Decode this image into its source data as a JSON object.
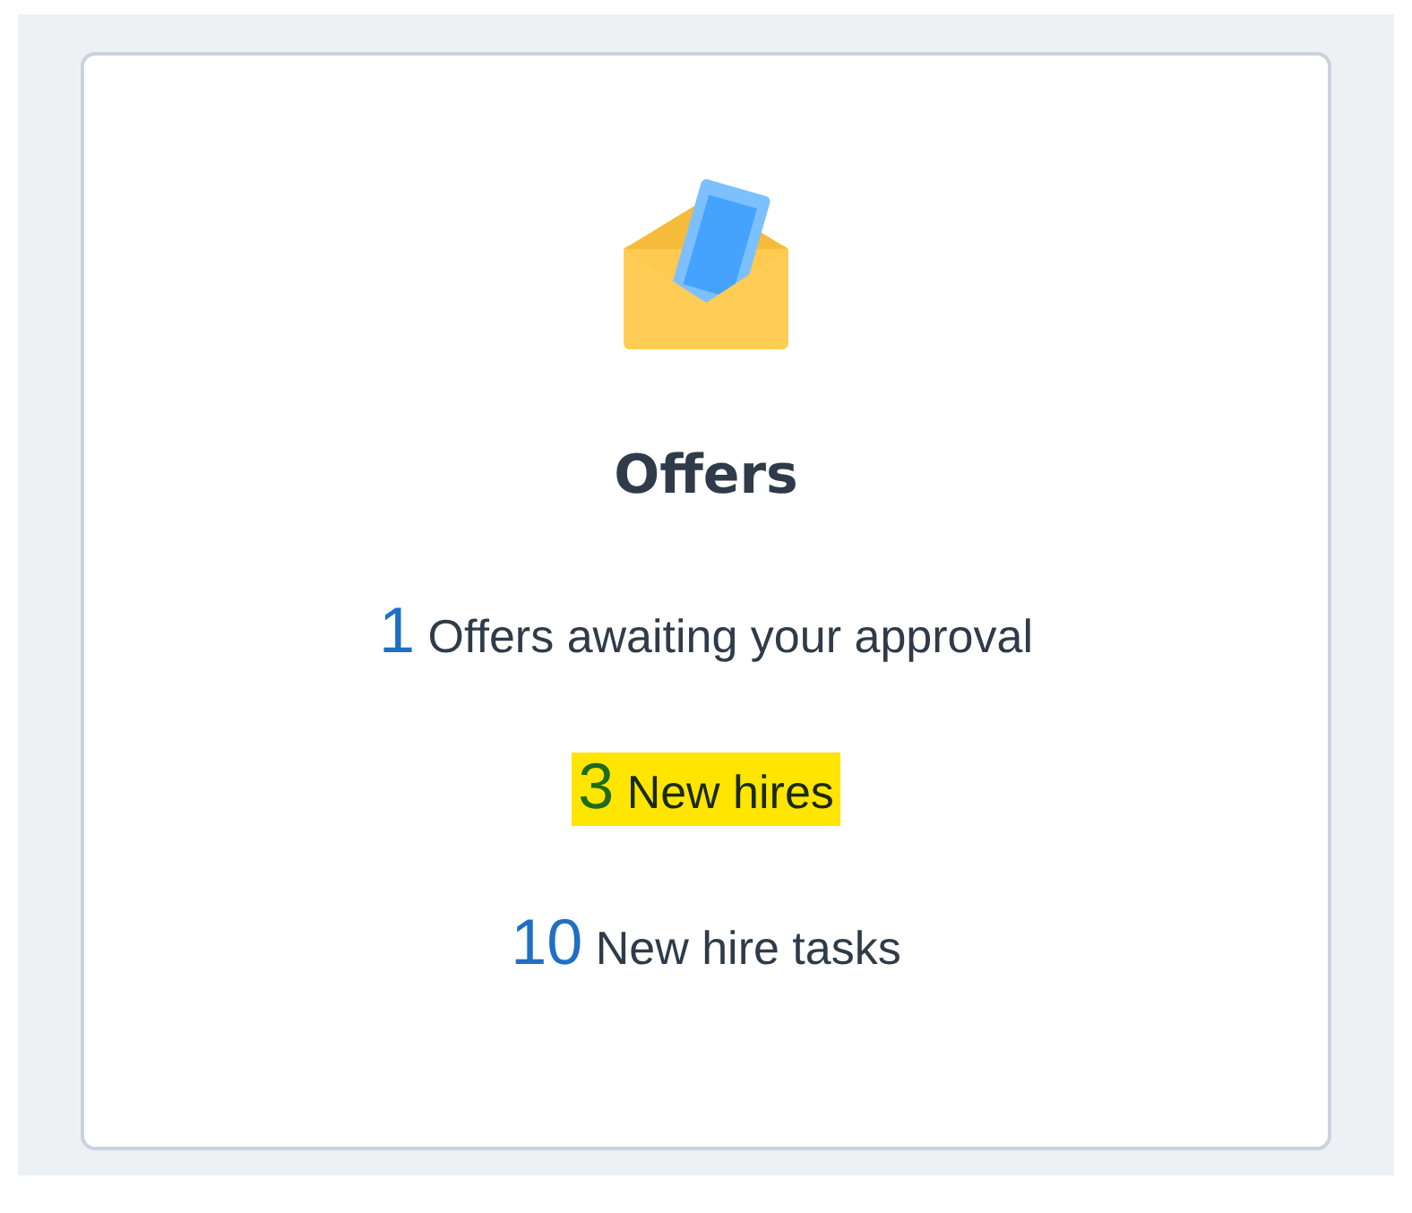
{
  "card": {
    "title": "Offers",
    "items": [
      {
        "count": "1",
        "label": "Offers awaiting your approval",
        "highlighted": false
      },
      {
        "count": "3",
        "label": "New hires",
        "highlighted": true
      },
      {
        "count": "10",
        "label": "New hire tasks",
        "highlighted": false
      }
    ]
  }
}
